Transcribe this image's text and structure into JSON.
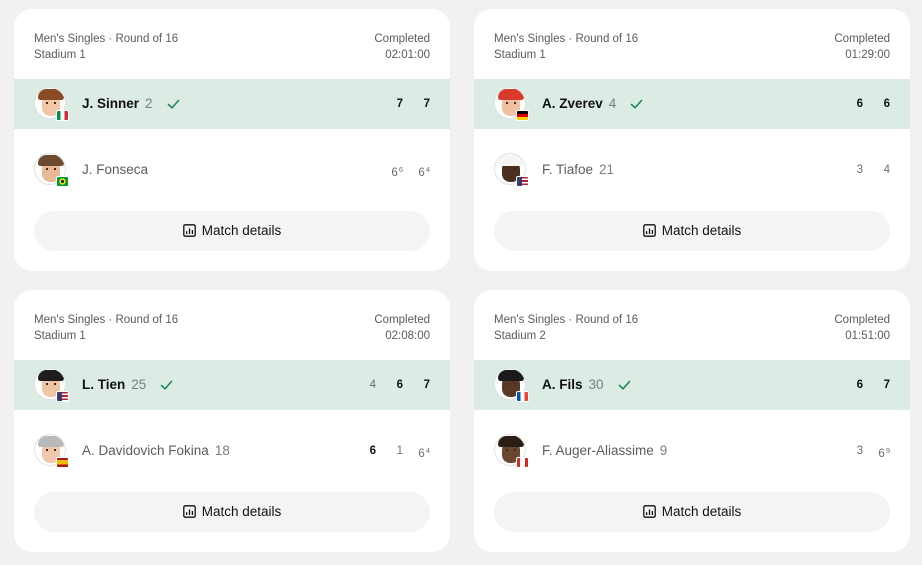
{
  "matches": [
    {
      "category": "Men's Singles · Round of 16",
      "court": "Stadium 1",
      "status": "Completed",
      "duration": "02:01:00",
      "details_label": "Match details",
      "players": [
        {
          "name": "J. Sinner",
          "seed": "2",
          "winner": true,
          "country_flag": "italy-flag",
          "scores": [
            {
              "v": "7",
              "tb": "",
              "won": true
            },
            {
              "v": "7",
              "tb": "",
              "won": true
            }
          ]
        },
        {
          "name": "J. Fonseca",
          "seed": "",
          "winner": false,
          "country_flag": "brazil-flag",
          "scores": [
            {
              "v": "6",
              "tb": "6",
              "won": false
            },
            {
              "v": "6",
              "tb": "4",
              "won": false
            }
          ]
        }
      ]
    },
    {
      "category": "Men's Singles · Round of 16",
      "court": "Stadium 1",
      "status": "Completed",
      "duration": "01:29:00",
      "details_label": "Match details",
      "players": [
        {
          "name": "A. Zverev",
          "seed": "4",
          "winner": true,
          "country_flag": "germany-flag",
          "scores": [
            {
              "v": "6",
              "tb": "",
              "won": true
            },
            {
              "v": "6",
              "tb": "",
              "won": true
            }
          ]
        },
        {
          "name": "F. Tiafoe",
          "seed": "21",
          "winner": false,
          "country_flag": "usa-flag",
          "scores": [
            {
              "v": "3",
              "tb": "",
              "won": false
            },
            {
              "v": "4",
              "tb": "",
              "won": false
            }
          ]
        }
      ]
    },
    {
      "category": "Men's Singles · Round of 16",
      "court": "Stadium 1",
      "status": "Completed",
      "duration": "02:08:00",
      "details_label": "Match details",
      "players": [
        {
          "name": "L. Tien",
          "seed": "25",
          "winner": true,
          "country_flag": "usa-flag",
          "scores": [
            {
              "v": "4",
              "tb": "",
              "won": false
            },
            {
              "v": "6",
              "tb": "",
              "won": true
            },
            {
              "v": "7",
              "tb": "",
              "won": true
            }
          ]
        },
        {
          "name": "A. Davidovich Fokina",
          "seed": "18",
          "winner": false,
          "country_flag": "spain-flag",
          "scores": [
            {
              "v": "6",
              "tb": "",
              "won": true
            },
            {
              "v": "1",
              "tb": "",
              "won": false
            },
            {
              "v": "6",
              "tb": "4",
              "won": false
            }
          ]
        }
      ]
    },
    {
      "category": "Men's Singles · Round of 16",
      "court": "Stadium 2",
      "status": "Completed",
      "duration": "01:51:00",
      "details_label": "Match details",
      "players": [
        {
          "name": "A. Fils",
          "seed": "30",
          "winner": true,
          "country_flag": "france-flag",
          "scores": [
            {
              "v": "6",
              "tb": "",
              "won": true
            },
            {
              "v": "7",
              "tb": "",
              "won": true
            }
          ]
        },
        {
          "name": "F. Auger-Aliassime",
          "seed": "9",
          "winner": false,
          "country_flag": "canada-flag",
          "scores": [
            {
              "v": "3",
              "tb": "",
              "won": false
            },
            {
              "v": "6",
              "tb": "9",
              "won": false
            }
          ]
        }
      ]
    }
  ],
  "colors": {
    "winner_row_bg": "#dcebe3",
    "check": "#1f8a55",
    "card_bg": "#ffffff",
    "page_bg": "#f1f1f1",
    "button_bg": "#f4f4f4"
  },
  "icons": {
    "winner_mark": "check-icon",
    "details_button": "bar-chart-icon"
  }
}
